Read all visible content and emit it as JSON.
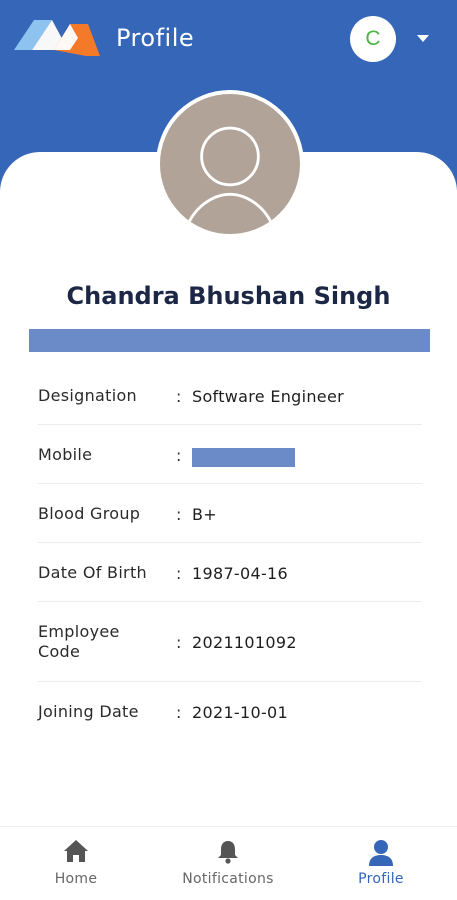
{
  "header": {
    "title": "Profile",
    "user_initial": "C",
    "icons": {
      "logo": "app-logo",
      "dropdown": "caret-down-icon"
    }
  },
  "profile": {
    "name": "Chandra Bhushan Singh",
    "photo": "default-avatar-icon",
    "fields": [
      {
        "label": "Designation",
        "value": "Software Engineer"
      },
      {
        "label": "Mobile",
        "value": ""
      },
      {
        "label": "Blood Group",
        "value": "B+"
      },
      {
        "label": "Date Of Birth",
        "value": "1987-04-16"
      },
      {
        "label": "Employee Code",
        "value": "2021101092"
      },
      {
        "label": "Joining Date",
        "value": "2021-10-01"
      }
    ],
    "separator": ":"
  },
  "nav": {
    "items": [
      {
        "label": "Home",
        "icon": "home-icon"
      },
      {
        "label": "Notifications",
        "icon": "bell-icon"
      },
      {
        "label": "Profile",
        "icon": "person-icon",
        "active": true
      }
    ]
  },
  "colors": {
    "primary": "#3566b7",
    "logo_orange": "#f47a2a",
    "logo_blue": "#5aa3e6",
    "initial_green": "#4cb640",
    "redaction": "#6a8bc7"
  }
}
